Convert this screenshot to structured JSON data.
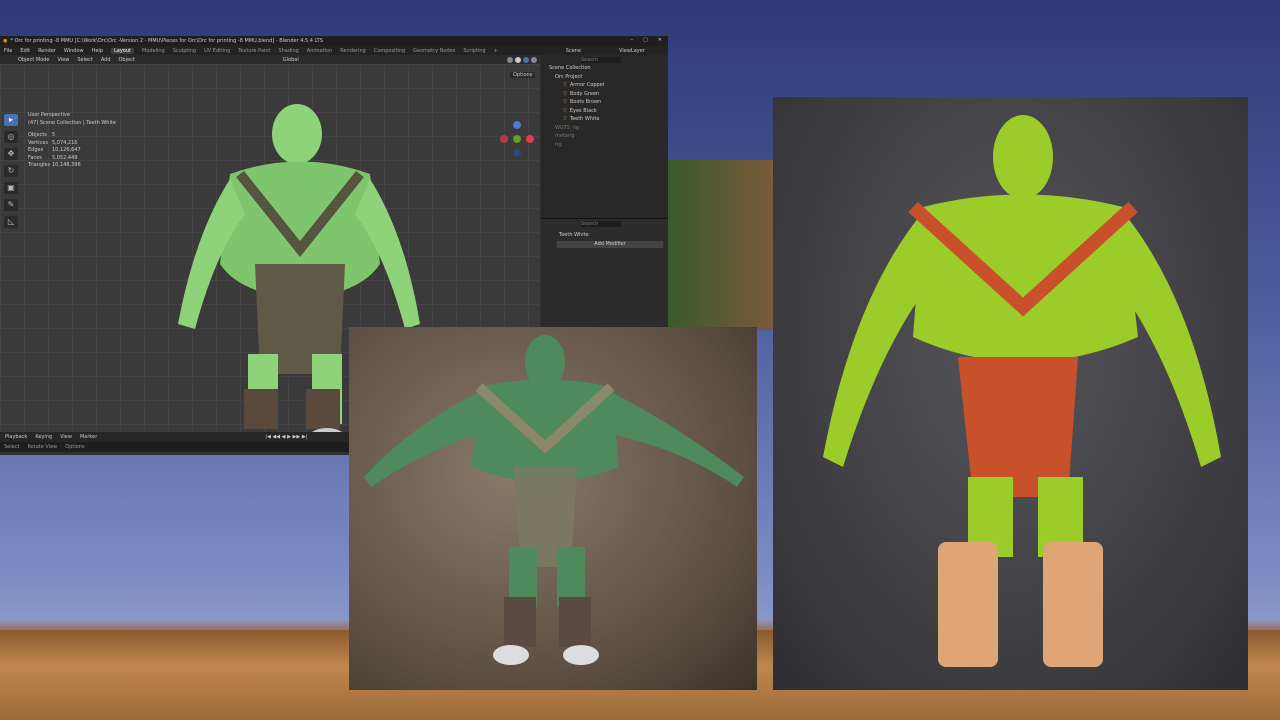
{
  "window": {
    "title": "* Orc for printing -8 MMU [C:\\Work\\Orc\\Orc -Version 2 - MMU\\Pieces for Orc\\Orc for printing -8 MMU.blend] - Blender 4.5.4 LTS",
    "controls": [
      "–",
      "▢",
      "✕"
    ]
  },
  "menu": [
    "File",
    "Edit",
    "Render",
    "Window",
    "Help"
  ],
  "workspaces": [
    "Layout",
    "Modeling",
    "Sculpting",
    "UV Editing",
    "Texture Paint",
    "Shading",
    "Animation",
    "Rendering",
    "Compositing",
    "Geometry Nodes",
    "Scripting",
    "+"
  ],
  "scene": "Scene",
  "view_layer": "ViewLayer",
  "viewport_header": {
    "mode": "Object Mode",
    "items": [
      "View",
      "Select",
      "Add",
      "Object"
    ],
    "orientation": "Global",
    "options": "Options"
  },
  "overlay": {
    "perspective": "User Perspective",
    "collection": "(47) Scene Collection | Teeth White"
  },
  "stats": [
    {
      "k": "Objects",
      "v": "5"
    },
    {
      "k": "Vertices",
      "v": "5,074,216"
    },
    {
      "k": "Edges",
      "v": "10,126,647"
    },
    {
      "k": "Faces",
      "v": "5,052,449"
    },
    {
      "k": "Triangles",
      "v": "10,148,396"
    }
  ],
  "outliner": {
    "search": "Search",
    "root": "Scene Collection",
    "items": [
      {
        "name": "Orc Project",
        "level": 1
      },
      {
        "name": "Armor Copper",
        "level": 2
      },
      {
        "name": "Body Green",
        "level": 2
      },
      {
        "name": "Boots Brown",
        "level": 2
      },
      {
        "name": "Eyes Black",
        "level": 2
      },
      {
        "name": "Teeth White",
        "level": 2
      },
      {
        "name": "WGTS_rig",
        "level": 1
      },
      {
        "name": "metarig",
        "level": 1
      },
      {
        "name": "rig",
        "level": 1
      }
    ]
  },
  "properties": {
    "search": "Search",
    "object": "Teeth White",
    "add_modifier": "Add Modifier"
  },
  "timeline": {
    "items": [
      "Playback",
      "Keying",
      "View",
      "Marker"
    ],
    "transport": "|◀ ◀◀ ◀ ▶ ▶▶ ▶|"
  },
  "statusbar": [
    "Select",
    "Rotate View",
    "Options"
  ],
  "colors": {
    "orc_green": "#8ed27a",
    "render_green": "#4e8a5c",
    "photo_green": "#9ccc2a",
    "copper": "#c8502a"
  }
}
